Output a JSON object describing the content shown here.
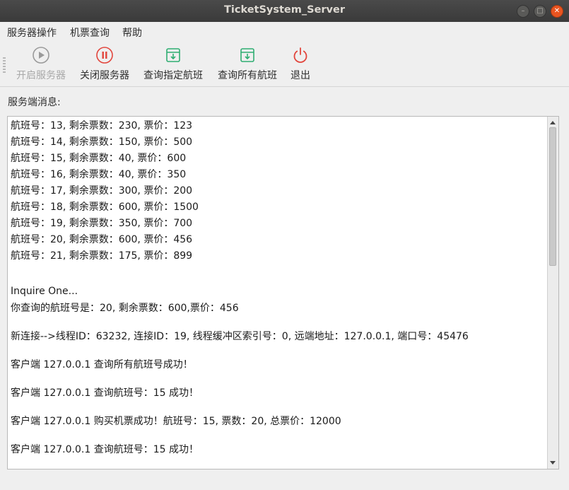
{
  "window": {
    "title": "TicketSystem_Server"
  },
  "menu": [
    "服务器操作",
    "机票查询",
    "帮助"
  ],
  "toolbar": {
    "start": "开启服务器",
    "stop": "关闭服务器",
    "query_one": "查询指定航班",
    "query_all": "查询所有航班",
    "exit": "退出"
  },
  "section_label": "服务端消息:",
  "log_lines": [
    "航班号：13, 剩余票数：230, 票价：123",
    "航班号：14, 剩余票数：150, 票价：500",
    "航班号：15, 剩余票数：40, 票价：600",
    "航班号：16, 剩余票数：40, 票价：350",
    "航班号：17, 剩余票数：300, 票价：200",
    "航班号：18, 剩余票数：600, 票价：1500",
    "航班号：19, 剩余票数：350, 票价：700",
    "航班号：20, 剩余票数：600, 票价：456",
    "航班号：21, 剩余票数：175, 票价：899",
    "Inquire One...",
    "你查询的航班号是：20, 剩余票数：600,票价：456",
    "新连接-->线程ID：63232, 连接ID：19, 线程缓冲区索引号：0, 远端地址：127.0.0.1, 端口号：45476",
    "客户端 127.0.0.1 查询所有航班号成功！",
    "客户端 127.0.0.1 查询航班号：15 成功！",
    "客户端 127.0.0.1 购买机票成功！航班号：15, 票数：20, 总票价：12000",
    "客户端 127.0.0.1 查询航班号：15 成功！"
  ]
}
